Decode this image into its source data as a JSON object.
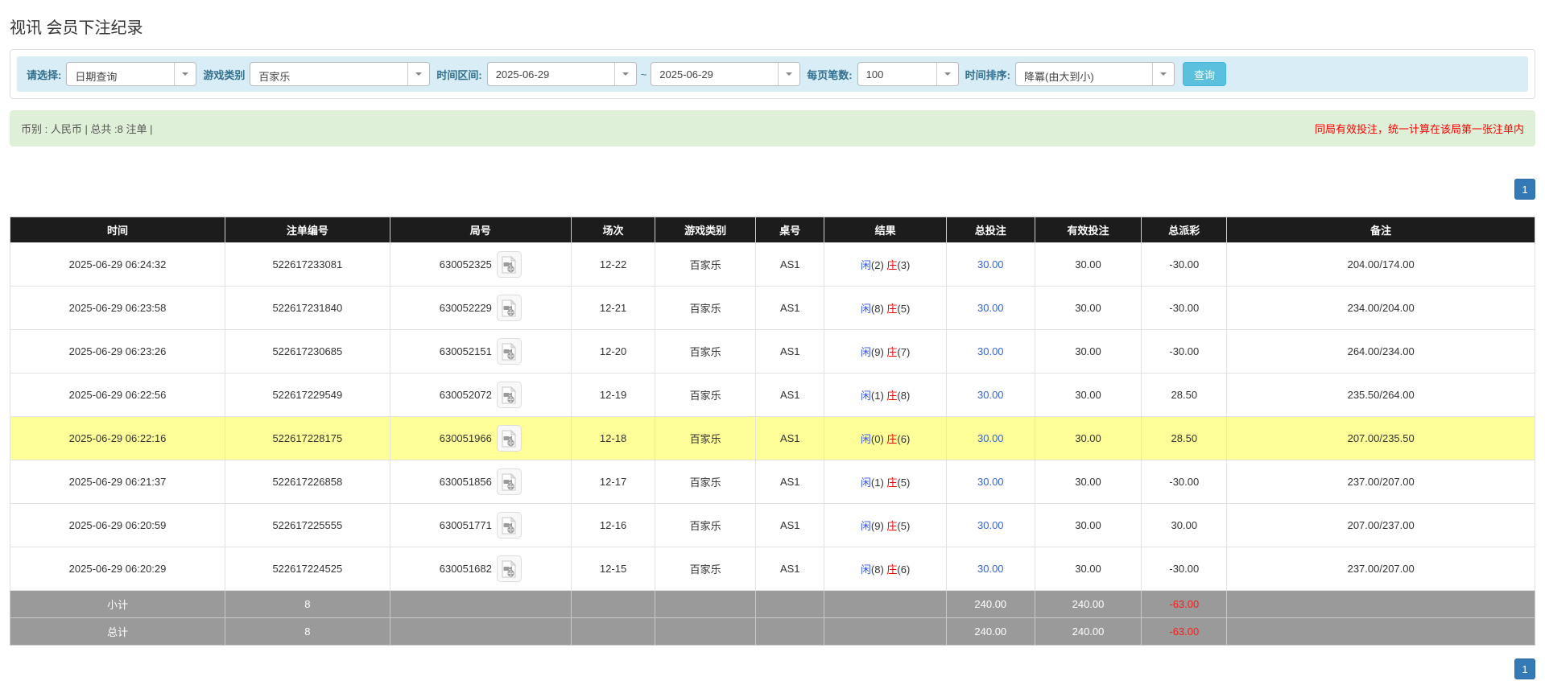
{
  "page": {
    "title": "视讯 会员下注纪录"
  },
  "filters": {
    "select_label": "请选择:",
    "select_value": "日期查询",
    "game_label": "游戏类别",
    "game_value": "百家乐",
    "range_label": "时间区间:",
    "date_from": "2025-06-29",
    "range_tilde": "~",
    "date_to": "2025-06-29",
    "perpage_label": "每页笔数:",
    "perpage_value": "100",
    "sort_label": "时间排序:",
    "sort_value": "降冪(由大到小)",
    "search_button": "查询"
  },
  "summary": {
    "left_text": "币别 : 人民币 | 总共 :8 注单 |",
    "right_note": "同局有效投注，统一计算在该局第一张注单内"
  },
  "pagination": {
    "page": "1"
  },
  "table": {
    "headers": [
      "时间",
      "注单编号",
      "局号",
      "场次",
      "游戏类别",
      "桌号",
      "结果",
      "总投注",
      "有效投注",
      "总派彩",
      "备注"
    ],
    "result_labels": {
      "player": "闲",
      "banker": "庄"
    },
    "video_icon_name": "video-record-icon",
    "rows": [
      {
        "time": "2025-06-29 06:24:32",
        "bet_no": "522617233081",
        "round_no": "630052325",
        "session": "12-22",
        "game": "百家乐",
        "table_no": "AS1",
        "result": {
          "player": "2",
          "banker": "3"
        },
        "total_bet": "30.00",
        "valid_bet": "30.00",
        "payout": "-30.00",
        "note": "204.00/174.00",
        "highlighted": false
      },
      {
        "time": "2025-06-29 06:23:58",
        "bet_no": "522617231840",
        "round_no": "630052229",
        "session": "12-21",
        "game": "百家乐",
        "table_no": "AS1",
        "result": {
          "player": "8",
          "banker": "5"
        },
        "total_bet": "30.00",
        "valid_bet": "30.00",
        "payout": "-30.00",
        "note": "234.00/204.00",
        "highlighted": false
      },
      {
        "time": "2025-06-29 06:23:26",
        "bet_no": "522617230685",
        "round_no": "630052151",
        "session": "12-20",
        "game": "百家乐",
        "table_no": "AS1",
        "result": {
          "player": "9",
          "banker": "7"
        },
        "total_bet": "30.00",
        "valid_bet": "30.00",
        "payout": "-30.00",
        "note": "264.00/234.00",
        "highlighted": false
      },
      {
        "time": "2025-06-29 06:22:56",
        "bet_no": "522617229549",
        "round_no": "630052072",
        "session": "12-19",
        "game": "百家乐",
        "table_no": "AS1",
        "result": {
          "player": "1",
          "banker": "8"
        },
        "total_bet": "30.00",
        "valid_bet": "30.00",
        "payout": "28.50",
        "note": "235.50/264.00",
        "highlighted": false
      },
      {
        "time": "2025-06-29 06:22:16",
        "bet_no": "522617228175",
        "round_no": "630051966",
        "session": "12-18",
        "game": "百家乐",
        "table_no": "AS1",
        "result": {
          "player": "0",
          "banker": "6"
        },
        "total_bet": "30.00",
        "valid_bet": "30.00",
        "payout": "28.50",
        "note": "207.00/235.50",
        "highlighted": true
      },
      {
        "time": "2025-06-29 06:21:37",
        "bet_no": "522617226858",
        "round_no": "630051856",
        "session": "12-17",
        "game": "百家乐",
        "table_no": "AS1",
        "result": {
          "player": "1",
          "banker": "5"
        },
        "total_bet": "30.00",
        "valid_bet": "30.00",
        "payout": "-30.00",
        "note": "237.00/207.00",
        "highlighted": false
      },
      {
        "time": "2025-06-29 06:20:59",
        "bet_no": "522617225555",
        "round_no": "630051771",
        "session": "12-16",
        "game": "百家乐",
        "table_no": "AS1",
        "result": {
          "player": "9",
          "banker": "5"
        },
        "total_bet": "30.00",
        "valid_bet": "30.00",
        "payout": "30.00",
        "note": "207.00/237.00",
        "highlighted": false
      },
      {
        "time": "2025-06-29 06:20:29",
        "bet_no": "522617224525",
        "round_no": "630051682",
        "session": "12-15",
        "game": "百家乐",
        "table_no": "AS1",
        "result": {
          "player": "8",
          "banker": "6"
        },
        "total_bet": "30.00",
        "valid_bet": "30.00",
        "payout": "-30.00",
        "note": "237.00/207.00",
        "highlighted": false
      }
    ],
    "footer": [
      {
        "label": "小计",
        "count": "8",
        "total_bet": "240.00",
        "valid_bet": "240.00",
        "payout": "-63.00"
      },
      {
        "label": "总计",
        "count": "8",
        "total_bet": "240.00",
        "valid_bet": "240.00",
        "payout": "-63.00"
      }
    ],
    "colors": {
      "header_bg": "#1c1c1c",
      "highlight_row": "#ffff99",
      "footer_bg": "#9a9a9a",
      "link_blue": "#3366dd",
      "negative_red": "#ff0000",
      "player_blue": "#3355ee",
      "banker_red": "#e60000",
      "filter_bar_bg": "#d9edf7",
      "summary_bar_bg": "#dff0d8",
      "pager_blue": "#337ab7",
      "search_btn": "#5bc0de"
    }
  }
}
